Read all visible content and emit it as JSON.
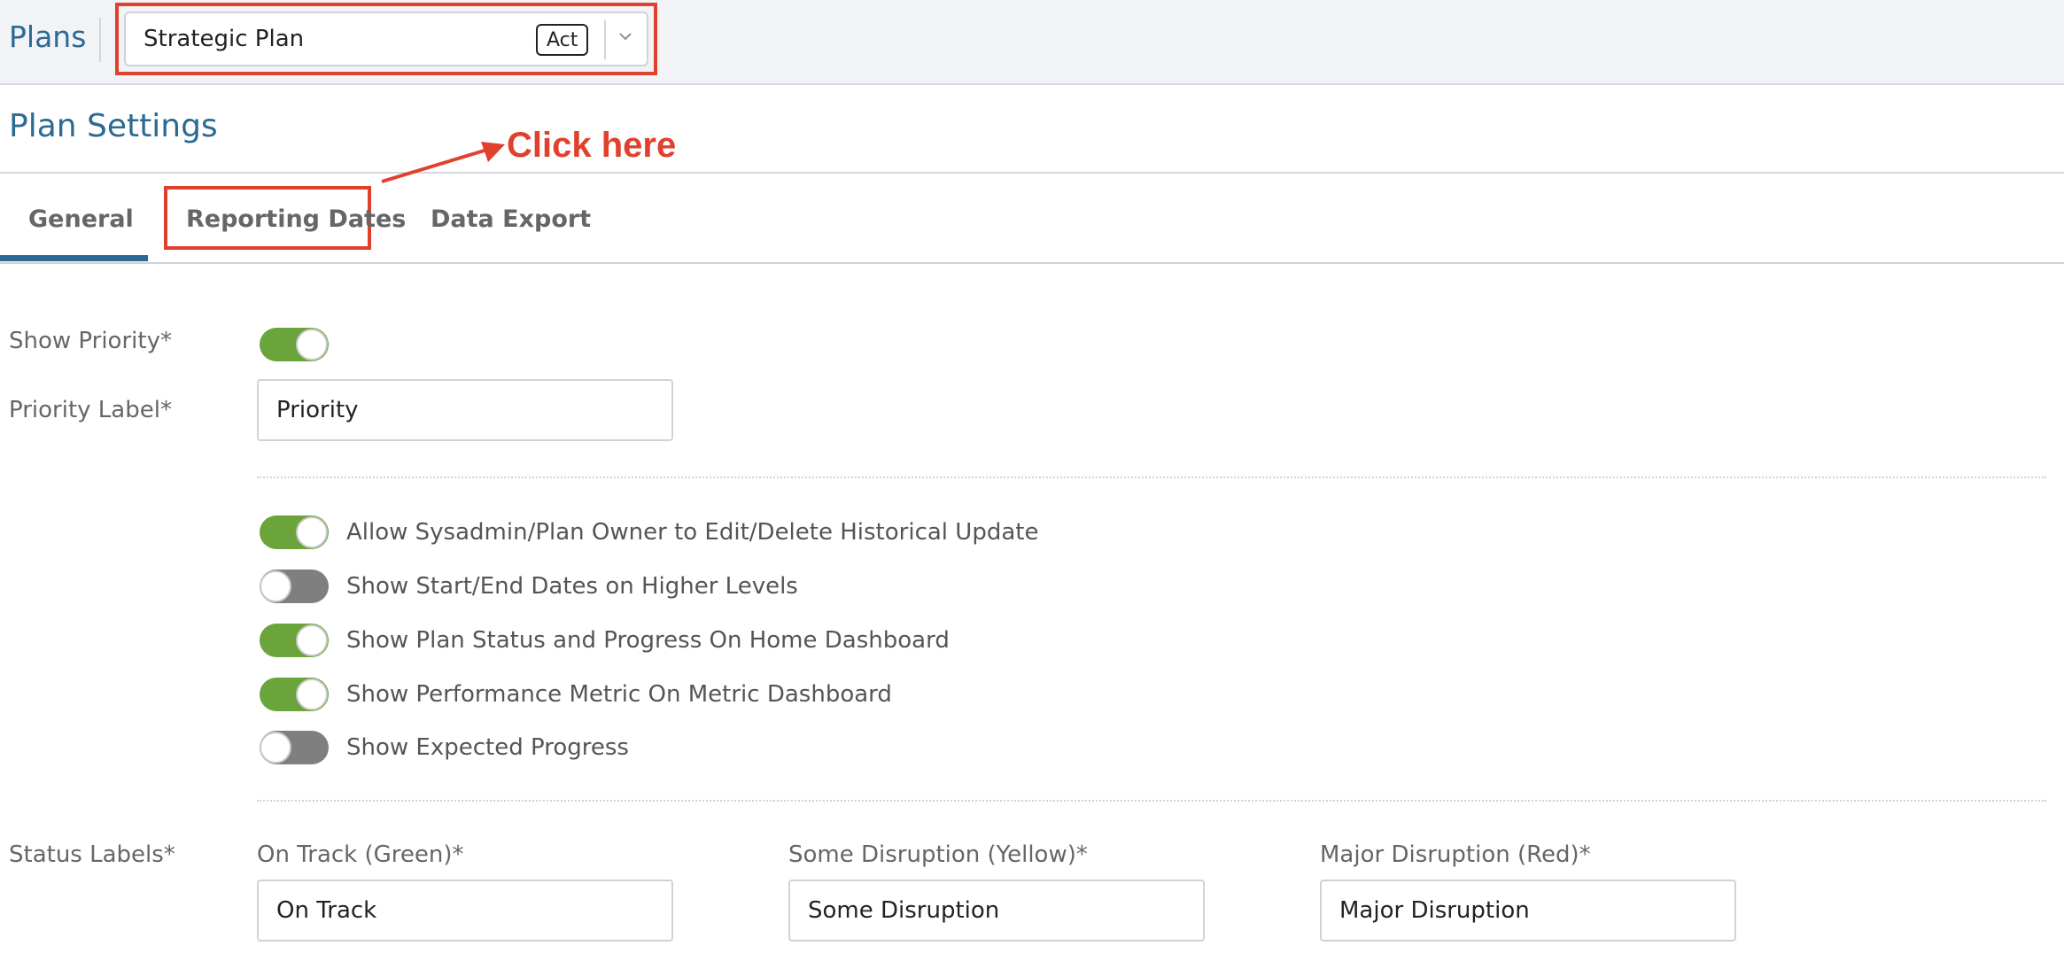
{
  "topbar": {
    "plans_link": "Plans",
    "plan_select": {
      "value": "Strategic Plan",
      "badge": "Act"
    }
  },
  "page": {
    "title": "Plan Settings"
  },
  "annotation": {
    "text": "Click here"
  },
  "tabs": [
    {
      "label": "General",
      "active": true
    },
    {
      "label": "Reporting Dates",
      "active": false
    },
    {
      "label": "Data Export",
      "active": false
    }
  ],
  "general": {
    "show_priority": {
      "label": "Show Priority*",
      "on": true
    },
    "priority_label": {
      "label": "Priority Label*",
      "value": "Priority"
    },
    "toggles": [
      {
        "label": "Allow Sysadmin/Plan Owner to Edit/Delete Historical Update",
        "on": true
      },
      {
        "label": "Show Start/End Dates on Higher Levels",
        "on": false
      },
      {
        "label": "Show Plan Status and Progress On Home Dashboard",
        "on": true
      },
      {
        "label": "Show Performance Metric On Metric Dashboard",
        "on": true
      },
      {
        "label": "Show Expected Progress",
        "on": false
      }
    ],
    "status_labels": {
      "label": "Status Labels*",
      "fields": [
        {
          "label": "On Track (Green)*",
          "value": "On Track"
        },
        {
          "label": "Some Disruption (Yellow)*",
          "value": "Some Disruption"
        },
        {
          "label": "Major Disruption (Red)*",
          "value": "Major Disruption"
        }
      ]
    }
  },
  "colors": {
    "accent": "#2b6a93",
    "highlight": "#e0412d",
    "toggle_on": "#6aa43a",
    "toggle_off": "#7f7f7f"
  }
}
